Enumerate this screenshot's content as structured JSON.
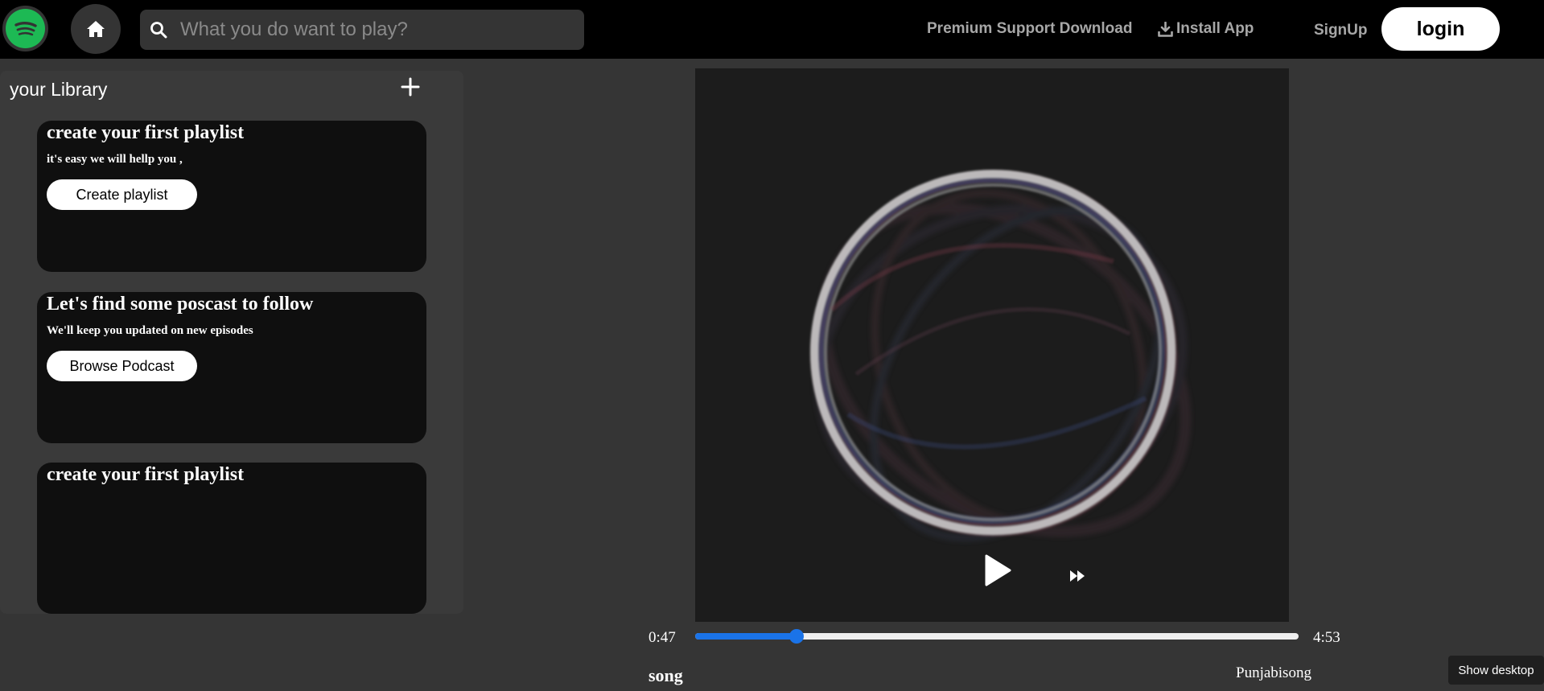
{
  "header": {
    "logo_icon": "spotify-logo-icon",
    "home_icon": "home-icon",
    "search": {
      "placeholder": "What you do want to play?",
      "value": "",
      "icon": "search-icon"
    },
    "premium_support_download": "Premium Support Download",
    "install_app": {
      "label": "Install App",
      "icon": "download-icon"
    },
    "signup": "SignUp",
    "login": "login"
  },
  "library": {
    "title": "your Library",
    "add_icon": "plus-icon",
    "cards": [
      {
        "title": "create your first playlist",
        "subtitle": "it's easy we will hellp you ,",
        "button": "Create playlist"
      },
      {
        "title": "Let's find some poscast to follow",
        "subtitle": "We'll keep you updated on new episodes",
        "button": "Browse Podcast"
      },
      {
        "title": "create your first playlist"
      }
    ]
  },
  "player": {
    "cover_icon": "ring-visualizer-artwork",
    "play_icon": "play-icon",
    "forward_icon": "fast-forward-icon",
    "current_time": "0:47",
    "total_time": "4:53",
    "progress_fraction": 0.168,
    "progress_color": "#1a73e8",
    "song": "song",
    "artist": "Punjabisong"
  },
  "taskbar": {
    "show_desktop": "Show desktop"
  },
  "colors": {
    "background": "#353535",
    "topbar": "#000000",
    "card": "#0f0f0f",
    "brand_green": "#1db954"
  }
}
